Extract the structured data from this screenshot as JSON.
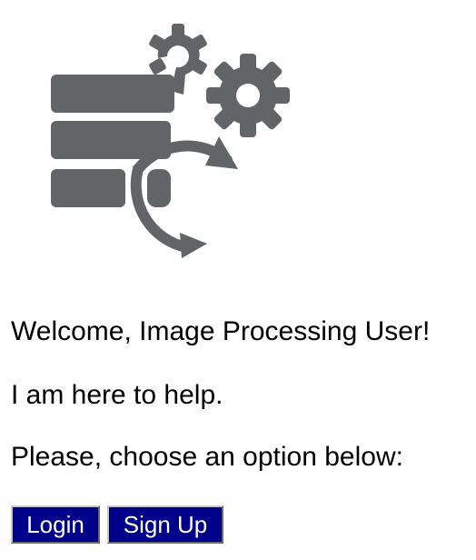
{
  "logo": {
    "icon": "database-gears-cycle-icon",
    "color": "#636468"
  },
  "main": {
    "welcome": "Welcome, Image Processing User!",
    "help": "I am here to help.",
    "prompt": "Please, choose an option below:"
  },
  "buttons": {
    "login_label": "Login",
    "signup_label": "Sign Up",
    "background": "#00008b",
    "text_color": "#ffffff"
  }
}
